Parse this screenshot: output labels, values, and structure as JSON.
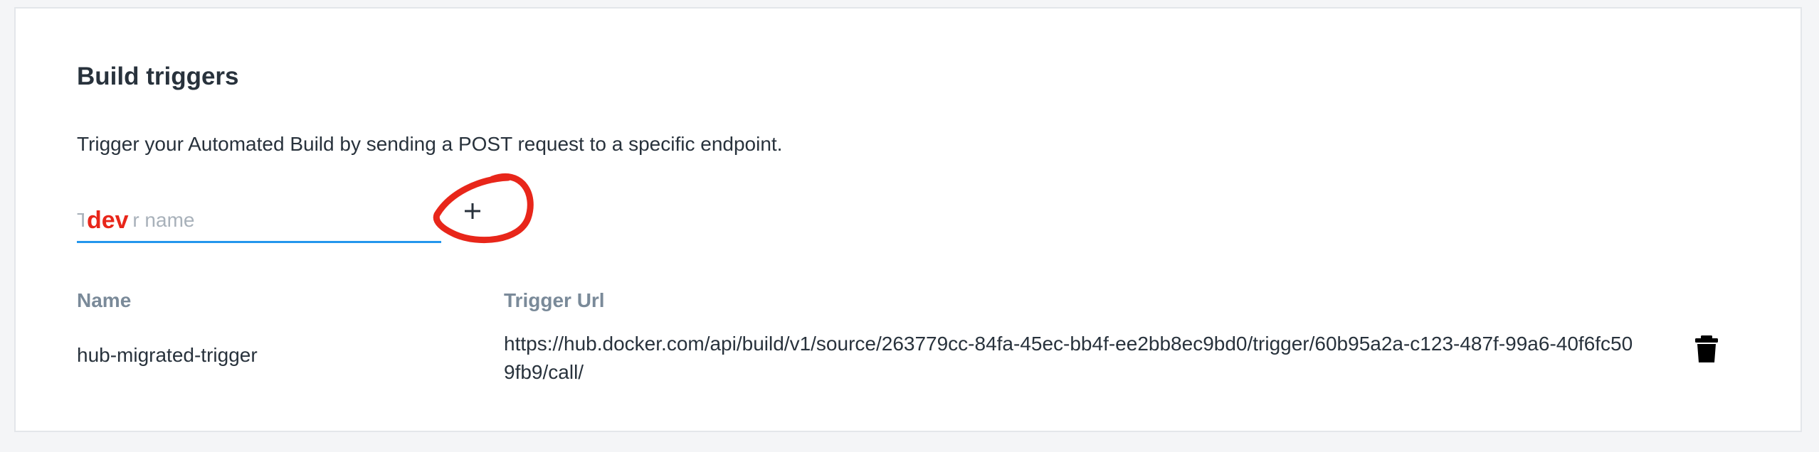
{
  "section": {
    "title": "Build triggers",
    "description": "Trigger your Automated Build by sending a POST request to a specific endpoint."
  },
  "form": {
    "trigger_name_placeholder": "Trigger name",
    "trigger_name_value": "dev",
    "add_button_label": "+"
  },
  "table": {
    "columns": [
      "Name",
      "Trigger Url"
    ],
    "rows": [
      {
        "name": "hub-migrated-trigger",
        "trigger_url": "https://hub.docker.com/api/build/v1/source/263779cc-84fa-45ec-bb4f-ee2bb8ec9bd0/trigger/60b95a2a-c123-487f-99a6-40f6fc509fb9/call/"
      }
    ]
  },
  "icons": {
    "add": "plus-icon",
    "delete": "trash-icon",
    "annotation": "red-circle-annotation"
  },
  "colors": {
    "accent": "#2396ed",
    "annotation": "#e8261a",
    "muted_header": "#7a8a99"
  }
}
